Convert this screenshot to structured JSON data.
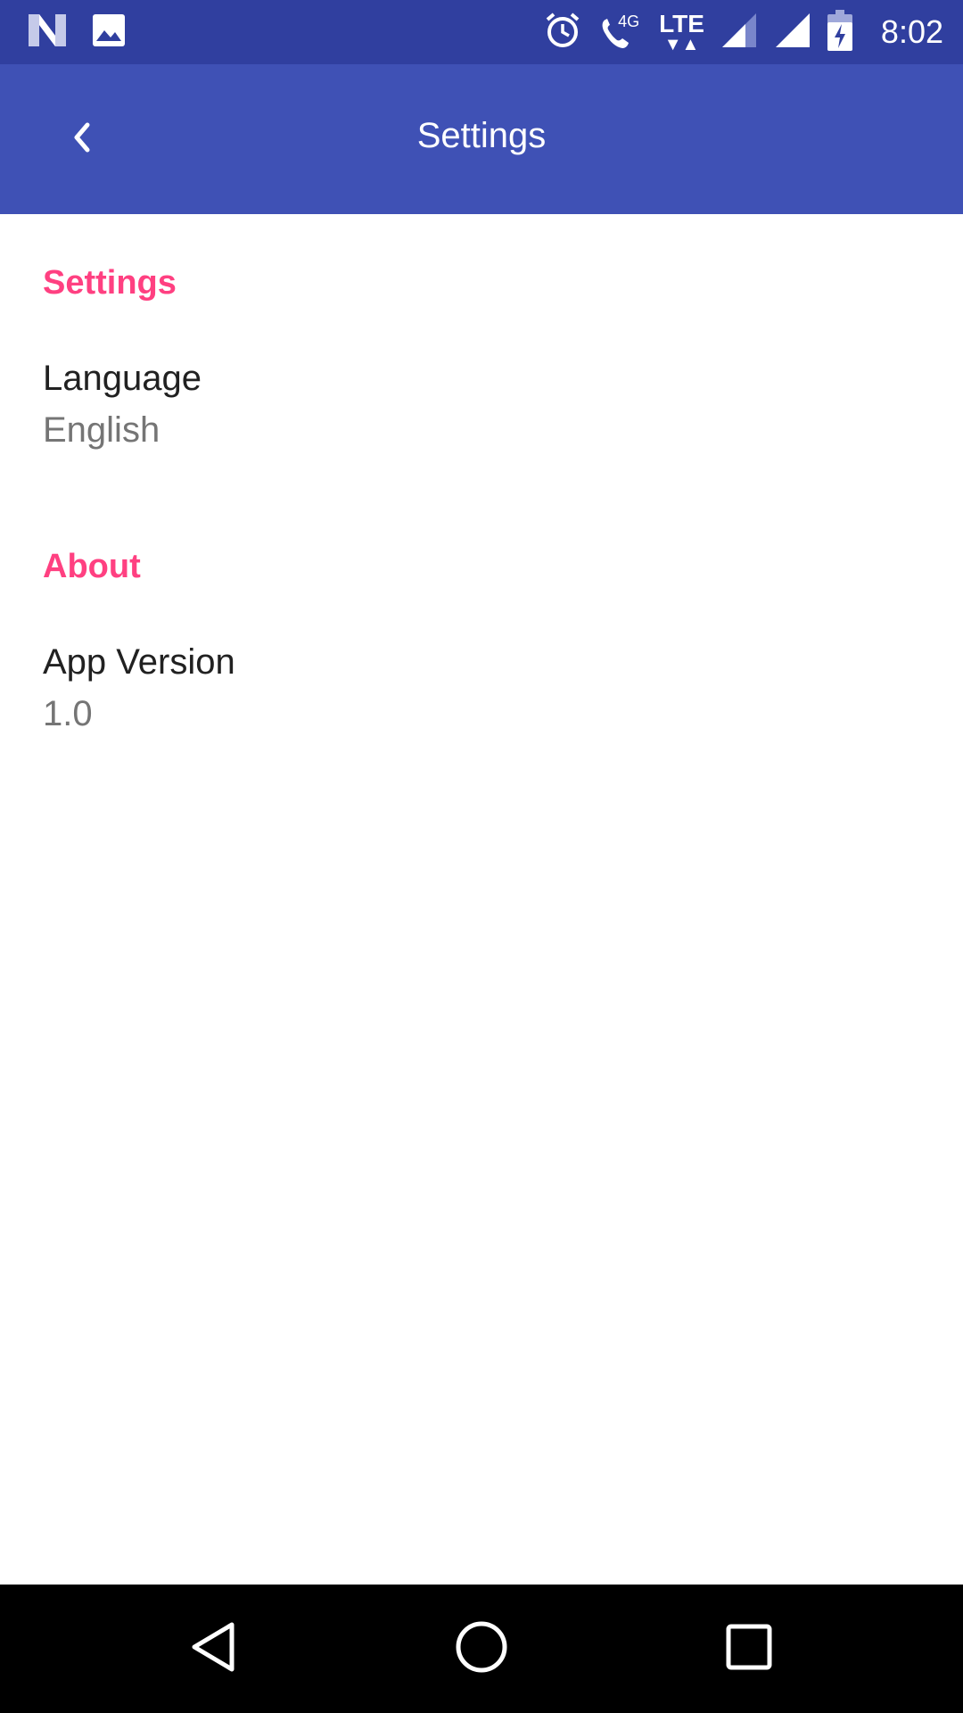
{
  "status_bar": {
    "time": "8:02",
    "network_badge": "4G",
    "lte_label": "LTE",
    "icons": [
      "n-logo-icon",
      "image-icon",
      "alarm-icon",
      "wifi-call-icon",
      "lte-icon",
      "signal-icon",
      "signal-icon",
      "battery-charging-icon"
    ]
  },
  "app_bar": {
    "title": "Settings",
    "back_icon": "chevron-left-icon"
  },
  "sections": [
    {
      "header": "Settings",
      "items": [
        {
          "title": "Language",
          "summary": "English"
        }
      ]
    },
    {
      "header": "About",
      "items": [
        {
          "title": "App Version",
          "summary": "1.0"
        }
      ]
    }
  ],
  "colors": {
    "status_bar": "#303F9F",
    "app_bar": "#3F51B5",
    "accent": "#FF4081",
    "primary_text": "#212121",
    "secondary_text": "#757575"
  }
}
